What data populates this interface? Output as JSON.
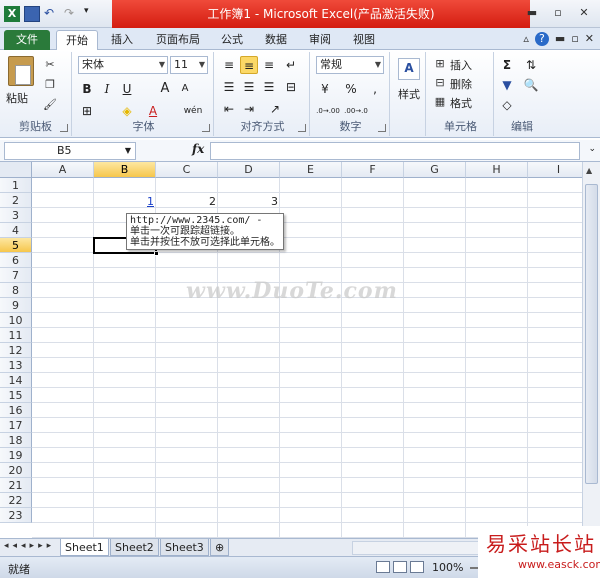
{
  "window": {
    "title": "工作簿1 - Microsoft Excel(产品激活失败)",
    "excel_logo": "X"
  },
  "ribbon_tabs": [
    {
      "label": "文件"
    },
    {
      "label": "开始"
    },
    {
      "label": "插入"
    },
    {
      "label": "页面布局"
    },
    {
      "label": "公式"
    },
    {
      "label": "数据"
    },
    {
      "label": "审阅"
    },
    {
      "label": "视图"
    }
  ],
  "clipboard": {
    "paste_label": "粘贴",
    "group_label": "剪贴板"
  },
  "font": {
    "font_name": "宋体",
    "font_size": "11",
    "bold": "B",
    "italic": "I",
    "underline": "U",
    "grow": "A",
    "shrink": "A",
    "font_color": "A",
    "wen": "wén",
    "group_label": "字体"
  },
  "alignment": {
    "group_label": "对齐方式"
  },
  "number": {
    "format": "常规",
    "percent": "%",
    "comma": ",",
    "inc_decimal": ".0→.00",
    "dec_decimal": ".00→.0",
    "group_label": "数字"
  },
  "styles": {
    "label": "样式"
  },
  "cells_group": {
    "insert": "插入",
    "delete": "删除",
    "format": "格式",
    "group_label": "单元格"
  },
  "editing": {
    "sum": "Σ",
    "group_label": "编辑"
  },
  "formula_bar": {
    "name_box": "B5",
    "fx": "fx",
    "formula": ""
  },
  "columns": [
    "A",
    "B",
    "C",
    "D",
    "E",
    "F",
    "G",
    "H",
    "I"
  ],
  "selected_column": "B",
  "rows": [
    "1",
    "2",
    "3",
    "4",
    "5",
    "6",
    "7",
    "8",
    "9",
    "10",
    "11",
    "12",
    "13",
    "14",
    "15",
    "16",
    "17",
    "18",
    "19",
    "20",
    "21",
    "22",
    "23"
  ],
  "selected_row": "5",
  "cells": {
    "b2": "1",
    "c2": "2",
    "d2": "3"
  },
  "tooltip": {
    "url": "http://www.2345.com/ -",
    "line1": "单击一次可跟踪超链接。",
    "line2": "单击并按住不放可选择此单元格。"
  },
  "watermark": "www.DuoTe.com",
  "sheets": [
    {
      "label": "Sheet1"
    },
    {
      "label": "Sheet2"
    },
    {
      "label": "Sheet3"
    }
  ],
  "status": {
    "ready": "就绪",
    "zoom": "100%"
  },
  "brand": {
    "text": "易采站长站",
    "url": "www.easck.com"
  }
}
